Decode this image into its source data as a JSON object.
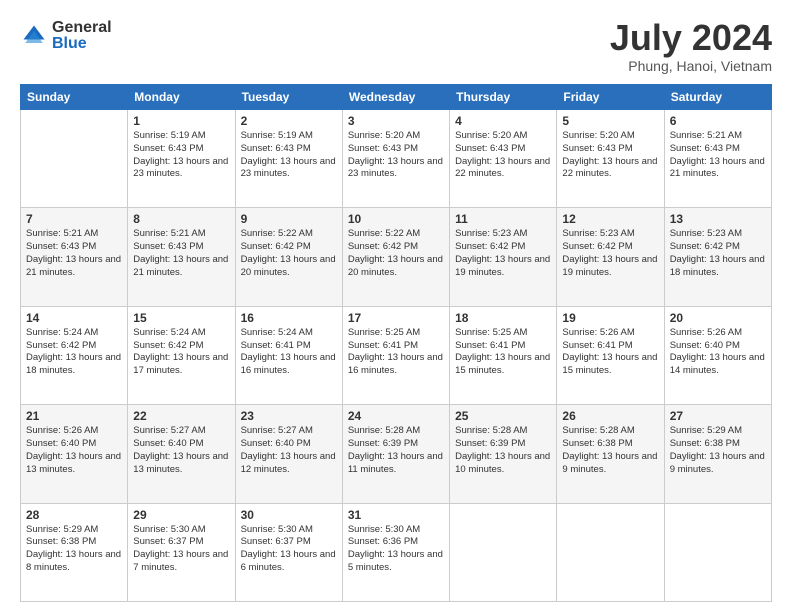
{
  "header": {
    "logo_general": "General",
    "logo_blue": "Blue",
    "month_year": "July 2024",
    "location": "Phung, Hanoi, Vietnam"
  },
  "days_of_week": [
    "Sunday",
    "Monday",
    "Tuesday",
    "Wednesday",
    "Thursday",
    "Friday",
    "Saturday"
  ],
  "weeks": [
    [
      {
        "day": "",
        "sunrise": "",
        "sunset": "",
        "daylight": ""
      },
      {
        "day": "1",
        "sunrise": "Sunrise: 5:19 AM",
        "sunset": "Sunset: 6:43 PM",
        "daylight": "Daylight: 13 hours and 23 minutes."
      },
      {
        "day": "2",
        "sunrise": "Sunrise: 5:19 AM",
        "sunset": "Sunset: 6:43 PM",
        "daylight": "Daylight: 13 hours and 23 minutes."
      },
      {
        "day": "3",
        "sunrise": "Sunrise: 5:20 AM",
        "sunset": "Sunset: 6:43 PM",
        "daylight": "Daylight: 13 hours and 23 minutes."
      },
      {
        "day": "4",
        "sunrise": "Sunrise: 5:20 AM",
        "sunset": "Sunset: 6:43 PM",
        "daylight": "Daylight: 13 hours and 22 minutes."
      },
      {
        "day": "5",
        "sunrise": "Sunrise: 5:20 AM",
        "sunset": "Sunset: 6:43 PM",
        "daylight": "Daylight: 13 hours and 22 minutes."
      },
      {
        "day": "6",
        "sunrise": "Sunrise: 5:21 AM",
        "sunset": "Sunset: 6:43 PM",
        "daylight": "Daylight: 13 hours and 21 minutes."
      }
    ],
    [
      {
        "day": "7",
        "sunrise": "Sunrise: 5:21 AM",
        "sunset": "Sunset: 6:43 PM",
        "daylight": "Daylight: 13 hours and 21 minutes."
      },
      {
        "day": "8",
        "sunrise": "Sunrise: 5:21 AM",
        "sunset": "Sunset: 6:43 PM",
        "daylight": "Daylight: 13 hours and 21 minutes."
      },
      {
        "day": "9",
        "sunrise": "Sunrise: 5:22 AM",
        "sunset": "Sunset: 6:42 PM",
        "daylight": "Daylight: 13 hours and 20 minutes."
      },
      {
        "day": "10",
        "sunrise": "Sunrise: 5:22 AM",
        "sunset": "Sunset: 6:42 PM",
        "daylight": "Daylight: 13 hours and 20 minutes."
      },
      {
        "day": "11",
        "sunrise": "Sunrise: 5:23 AM",
        "sunset": "Sunset: 6:42 PM",
        "daylight": "Daylight: 13 hours and 19 minutes."
      },
      {
        "day": "12",
        "sunrise": "Sunrise: 5:23 AM",
        "sunset": "Sunset: 6:42 PM",
        "daylight": "Daylight: 13 hours and 19 minutes."
      },
      {
        "day": "13",
        "sunrise": "Sunrise: 5:23 AM",
        "sunset": "Sunset: 6:42 PM",
        "daylight": "Daylight: 13 hours and 18 minutes."
      }
    ],
    [
      {
        "day": "14",
        "sunrise": "Sunrise: 5:24 AM",
        "sunset": "Sunset: 6:42 PM",
        "daylight": "Daylight: 13 hours and 18 minutes."
      },
      {
        "day": "15",
        "sunrise": "Sunrise: 5:24 AM",
        "sunset": "Sunset: 6:42 PM",
        "daylight": "Daylight: 13 hours and 17 minutes."
      },
      {
        "day": "16",
        "sunrise": "Sunrise: 5:24 AM",
        "sunset": "Sunset: 6:41 PM",
        "daylight": "Daylight: 13 hours and 16 minutes."
      },
      {
        "day": "17",
        "sunrise": "Sunrise: 5:25 AM",
        "sunset": "Sunset: 6:41 PM",
        "daylight": "Daylight: 13 hours and 16 minutes."
      },
      {
        "day": "18",
        "sunrise": "Sunrise: 5:25 AM",
        "sunset": "Sunset: 6:41 PM",
        "daylight": "Daylight: 13 hours and 15 minutes."
      },
      {
        "day": "19",
        "sunrise": "Sunrise: 5:26 AM",
        "sunset": "Sunset: 6:41 PM",
        "daylight": "Daylight: 13 hours and 15 minutes."
      },
      {
        "day": "20",
        "sunrise": "Sunrise: 5:26 AM",
        "sunset": "Sunset: 6:40 PM",
        "daylight": "Daylight: 13 hours and 14 minutes."
      }
    ],
    [
      {
        "day": "21",
        "sunrise": "Sunrise: 5:26 AM",
        "sunset": "Sunset: 6:40 PM",
        "daylight": "Daylight: 13 hours and 13 minutes."
      },
      {
        "day": "22",
        "sunrise": "Sunrise: 5:27 AM",
        "sunset": "Sunset: 6:40 PM",
        "daylight": "Daylight: 13 hours and 13 minutes."
      },
      {
        "day": "23",
        "sunrise": "Sunrise: 5:27 AM",
        "sunset": "Sunset: 6:40 PM",
        "daylight": "Daylight: 13 hours and 12 minutes."
      },
      {
        "day": "24",
        "sunrise": "Sunrise: 5:28 AM",
        "sunset": "Sunset: 6:39 PM",
        "daylight": "Daylight: 13 hours and 11 minutes."
      },
      {
        "day": "25",
        "sunrise": "Sunrise: 5:28 AM",
        "sunset": "Sunset: 6:39 PM",
        "daylight": "Daylight: 13 hours and 10 minutes."
      },
      {
        "day": "26",
        "sunrise": "Sunrise: 5:28 AM",
        "sunset": "Sunset: 6:38 PM",
        "daylight": "Daylight: 13 hours and 9 minutes."
      },
      {
        "day": "27",
        "sunrise": "Sunrise: 5:29 AM",
        "sunset": "Sunset: 6:38 PM",
        "daylight": "Daylight: 13 hours and 9 minutes."
      }
    ],
    [
      {
        "day": "28",
        "sunrise": "Sunrise: 5:29 AM",
        "sunset": "Sunset: 6:38 PM",
        "daylight": "Daylight: 13 hours and 8 minutes."
      },
      {
        "day": "29",
        "sunrise": "Sunrise: 5:30 AM",
        "sunset": "Sunset: 6:37 PM",
        "daylight": "Daylight: 13 hours and 7 minutes."
      },
      {
        "day": "30",
        "sunrise": "Sunrise: 5:30 AM",
        "sunset": "Sunset: 6:37 PM",
        "daylight": "Daylight: 13 hours and 6 minutes."
      },
      {
        "day": "31",
        "sunrise": "Sunrise: 5:30 AM",
        "sunset": "Sunset: 6:36 PM",
        "daylight": "Daylight: 13 hours and 5 minutes."
      },
      {
        "day": "",
        "sunrise": "",
        "sunset": "",
        "daylight": ""
      },
      {
        "day": "",
        "sunrise": "",
        "sunset": "",
        "daylight": ""
      },
      {
        "day": "",
        "sunrise": "",
        "sunset": "",
        "daylight": ""
      }
    ]
  ]
}
